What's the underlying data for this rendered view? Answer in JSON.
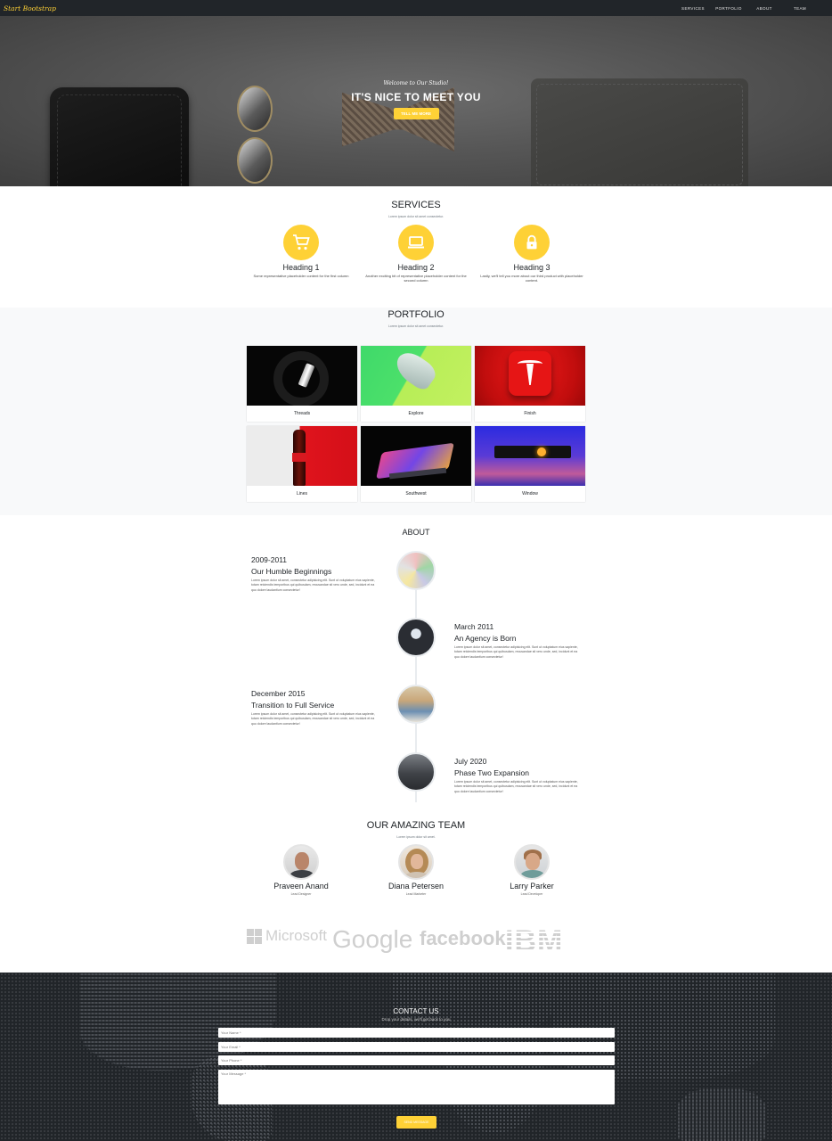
{
  "navbar": {
    "brand": "Start Bootstrap",
    "links": [
      "SERVICES",
      "PORTFOLIO",
      "ABOUT",
      "TEAM"
    ]
  },
  "hero": {
    "subheading": "Welcome to Our Studio!",
    "heading": "IT'S NICE TO MEET YOU",
    "button": "TELL ME MORE"
  },
  "services": {
    "title": "SERVICES",
    "subtitle": "Lorem ipsum dolor sit amet consectetur.",
    "items": [
      {
        "heading": "Heading 1",
        "text": "Some representative placeholder content for the first column",
        "icon": "shopping-cart-icon"
      },
      {
        "heading": "Heading 2",
        "text": "Another exciting bit of representative placeholder content for the second column",
        "icon": "laptop-icon"
      },
      {
        "heading": "Heading 3",
        "text": "Lastly, we'll tell you more about our third product with placeholder content.",
        "icon": "lock-icon"
      }
    ]
  },
  "portfolio": {
    "title": "PORTFOLIO",
    "subtitle": "Lorem ipsum dolor sit amet consectetur.",
    "items": [
      "Threads",
      "Explore",
      "Finish",
      "Lines",
      "Southwest",
      "Window"
    ]
  },
  "about": {
    "title": "ABOUT",
    "entries": [
      {
        "date": "2009-2011",
        "heading": "Our Humble Beginnings",
        "text": "Lorem ipsum dolor sit amet, consectetur adipisicing elit. Sunt ut voluptatum eius sapiente, totam reiciendis temporibus qui quibusdam, recusandae sit vero unde, sed, incidunt et ea quo dolore laudantium consectetur!"
      },
      {
        "date": "March 2011",
        "heading": "An Agency is Born",
        "text": "Lorem ipsum dolor sit amet, consectetur adipisicing elit. Sunt ut voluptatum eius sapiente, totam reiciendis temporibus qui quibusdam, recusandae sit vero unde, sed, incidunt et ea quo dolore laudantium consectetur!"
      },
      {
        "date": "December 2015",
        "heading": "Transition to Full Service",
        "text": "Lorem ipsum dolor sit amet, consectetur adipisicing elit. Sunt ut voluptatum eius sapiente, totam reiciendis temporibus qui quibusdam, recusandae sit vero unde, sed, incidunt et ea quo dolore laudantium consectetur!"
      },
      {
        "date": "July 2020",
        "heading": "Phase Two Expansion",
        "text": "Lorem ipsum dolor sit amet, consectetur adipisicing elit. Sunt ut voluptatum eius sapiente, totam reiciendis temporibus qui quibusdam, recusandae sit vero unde, sed, incidunt et ea quo dolore laudantium consectetur!"
      }
    ]
  },
  "team": {
    "title": "OUR AMAZING TEAM",
    "subtitle": "Lorem ipsum dolor sit amet.",
    "members": [
      {
        "name": "Praveen Anand",
        "role": "Lead Designer"
      },
      {
        "name": "Diana Petersen",
        "role": "Lead Marketer"
      },
      {
        "name": "Larry Parker",
        "role": "Lead Developer"
      }
    ]
  },
  "clients": [
    "Microsoft",
    "Google",
    "facebook",
    "IBM"
  ],
  "contact": {
    "title": "CONTACT US",
    "subtitle": "Drop your details, we'll get back to you",
    "name_placeholder": "Your Name *",
    "email_placeholder": "Your Email *",
    "phone_placeholder": "Your Phone *",
    "message_placeholder": "Your Message *",
    "button": "SEND MESSAGE"
  },
  "colors": {
    "accent": "#fed136",
    "dark": "#212529",
    "light": "#f8f9fa"
  }
}
